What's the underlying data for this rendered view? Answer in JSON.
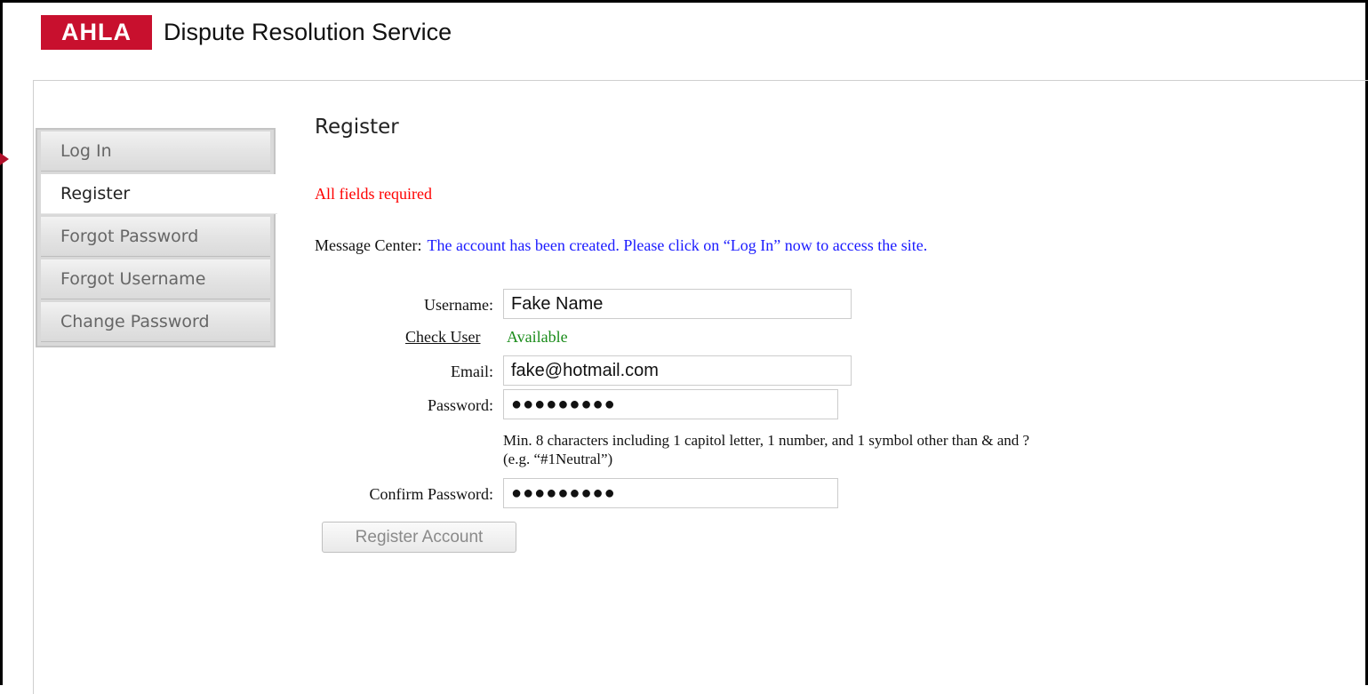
{
  "header": {
    "logo_text": "AHLA",
    "title": "Dispute Resolution Service",
    "brand_color": "#c8102e"
  },
  "sidebar": {
    "items": [
      {
        "label": "Log In",
        "active": false
      },
      {
        "label": "Register",
        "active": true
      },
      {
        "label": "Forgot Password",
        "active": false
      },
      {
        "label": "Forgot Username",
        "active": false
      },
      {
        "label": "Change Password",
        "active": false
      }
    ]
  },
  "main": {
    "title": "Register",
    "required_note": "All fields required",
    "message_center_label": "Message Center:",
    "message_center_text": "The account has been created. Please click on “Log In” now to access the site.",
    "username": {
      "label": "Username:",
      "value": "Fake Name"
    },
    "check_user": {
      "label": "Check User",
      "status": "Available"
    },
    "email": {
      "label": "Email:",
      "value": "fake@hotmail.com"
    },
    "password": {
      "label": "Password:",
      "value": "●●●●●●●●●"
    },
    "password_hint_line1": "Min. 8 characters including 1 capitol letter, 1 number, and 1 symbol other than & and ?",
    "password_hint_line2": "(e.g. “#1Neutral”)",
    "confirm_password": {
      "label": "Confirm Password:",
      "value": "●●●●●●●●●"
    },
    "submit_label": "Register Account"
  },
  "colors": {
    "error_text": "#ff0000",
    "message_text": "#1a1aff",
    "available_text": "#1a8c1a"
  }
}
